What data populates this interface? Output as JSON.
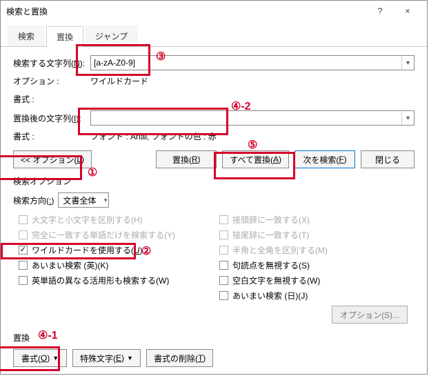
{
  "window": {
    "title": "検索と置換",
    "help": "?",
    "close": "×"
  },
  "tabs": {
    "search": "検索",
    "replace": "置換",
    "jump": "ジャンプ"
  },
  "findLabelPre": "検索する文字列(",
  "findLabelU": "N",
  "findLabelPost": "):",
  "findValue": "[a-zA-Z0-9]",
  "optionsLabel": "オプション :",
  "optionsValue": "ワイルドカード",
  "formatLabel": "書式 :",
  "replaceLabelPre": "置換後の文字列(",
  "replaceLabelU": "I",
  "replaceLabelPost": "):",
  "replaceValue": "",
  "replaceFormatInfo": "フォント : Arial, フォントの色 : 赤",
  "btnOptions": "<< オプション(",
  "btnOptionsU": "L",
  "btnOptionsEnd": ")",
  "btnReplacePre": "置換(",
  "btnReplaceU": "R",
  "btnReplaceAllPre": "すべて置換(",
  "btnReplaceAllU": "A",
  "btnFindNextPre": "次を検索(",
  "btnFindNextU": "F",
  "btnClose": "閉じる",
  "searchOptionsTitle": "検索オプション",
  "searchDirLabelPre": "検索方向(",
  "searchDirU": ":",
  "searchDirValue": "文書全体",
  "chk": {
    "matchCase": "大文字と小文字を区別する(H)",
    "wholeWord": "完全に一致する単語だけを検索する(Y)",
    "wildcardPre": "ワイルドカードを使用する(",
    "wildcardU": "U",
    "fuzzy": "あいまい検索 (英)(K)",
    "wordForms": "英単語の異なる活用形も検索する(W)",
    "prefix": "接頭辞に一致する(X)",
    "suffix": "接尾辞に一致する(T)",
    "halfFull": "半角と全角を区別する(M)",
    "punct": "句読点を無視する(S)",
    "white": "空白文字を無視する(W)",
    "fuzzyJ": "あいまい検索 (日)(J)",
    "optS": "オプション(S)..."
  },
  "replaceSection": "置換",
  "btnFormatPre": "書式(",
  "btnFormatU": "O",
  "btnSpecialPre": "特殊文字(",
  "btnSpecialU": "E",
  "btnNoFmtPre": "書式の削除(",
  "btnNoFmtU": "T",
  "annotations": {
    "a1": "①",
    "a2": "②",
    "a3": "③",
    "a41": "④-1",
    "a42": "④-2",
    "a5": "⑤"
  }
}
